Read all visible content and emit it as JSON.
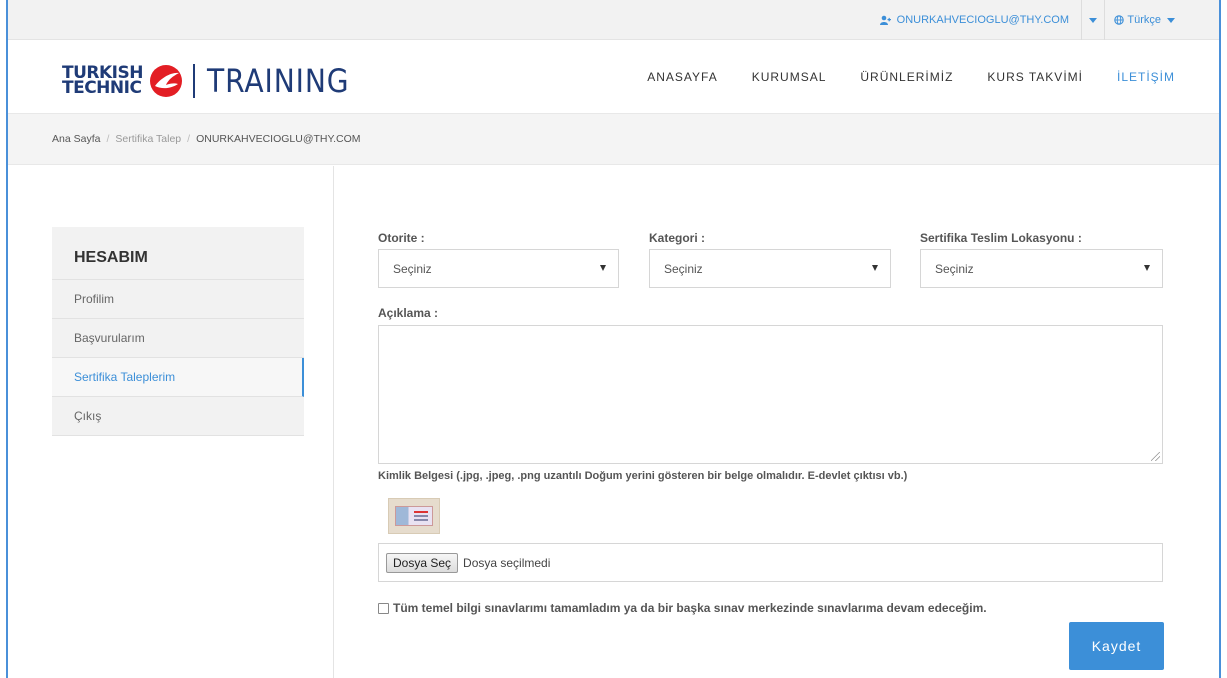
{
  "topbar": {
    "user_email": "ONURKAHVECIOGLU@THY.COM",
    "language": "Türkçe"
  },
  "brand": {
    "line1": "TURKISH",
    "line2": "TECHNIC",
    "product": "TRAINING",
    "color": "#1f3b77"
  },
  "nav": {
    "items": [
      "ANASAYFA",
      "KURUMSAL",
      "ÜRÜNLERİMİZ",
      "KURS TAKVİMİ",
      "İLETİŞİM"
    ],
    "active_index": 4,
    "accent": "#3c8fd8"
  },
  "breadcrumb": {
    "home": "Ana Sayfa",
    "section": "Sertifika Talep",
    "current": "ONURKAHVECIOGLU@THY.COM"
  },
  "sidebar": {
    "title": "HESABIM",
    "items": [
      "Profilim",
      "Başvurularım",
      "Sertifika Taleplerim",
      "Çıkış"
    ],
    "active_index": 2
  },
  "form": {
    "otorite_label": "Otorite :",
    "otorite_value": "Seçiniz",
    "kategori_label": "Kategori :",
    "kategori_value": "Seçiniz",
    "lokasyon_label": "Sertifika Teslim Lokasyonu :",
    "lokasyon_value": "Seçiniz",
    "aciklama_label": "Açıklama :",
    "aciklama_value": "",
    "kimlik_label": "Kimlik Belgesi (.jpg, .jpeg, .png uzantılı Doğum yerini gösteren bir belge olmalıdır. E-devlet çıktısı vb.)",
    "file_button": "Dosya Seç",
    "file_status": "Dosya seçilmedi",
    "checkbox_label": "Tüm temel bilgi sınavlarımı tamamladım ya da bir başka sınav merkezinde sınavlarıma devam edeceğim.",
    "checkbox_checked": false,
    "save_label": "Kaydet"
  }
}
